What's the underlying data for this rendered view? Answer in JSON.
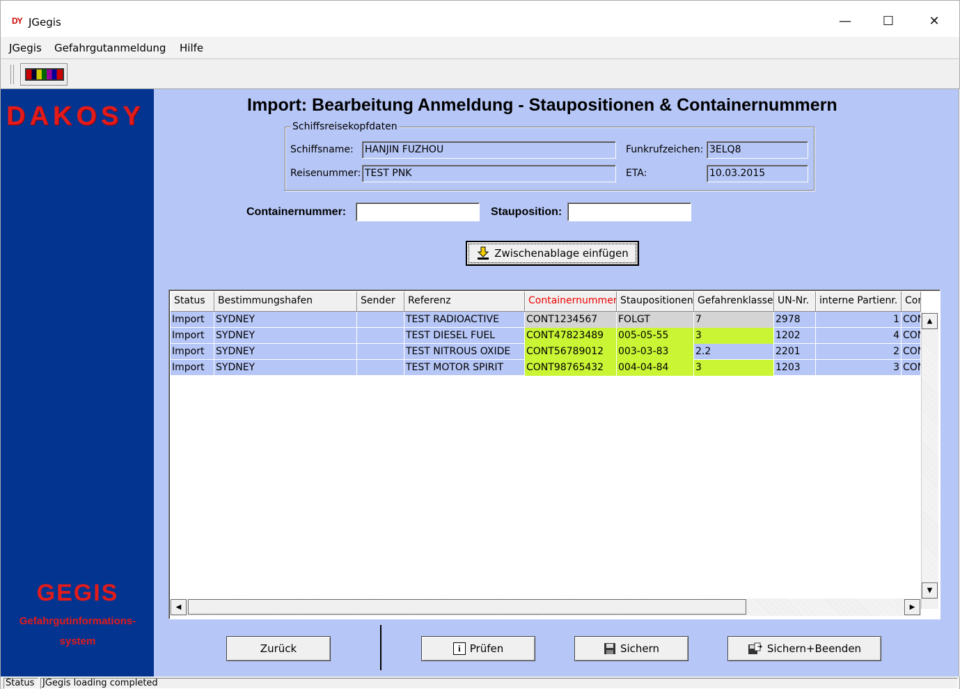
{
  "window": {
    "logo": "DY",
    "title": "JGegis",
    "minimize_glyph": "—",
    "maximize_glyph": "☐",
    "close_glyph": "✕"
  },
  "menu": [
    "JGegis",
    "Gefahrgutanmeldung",
    "Hilfe"
  ],
  "toolbar": {
    "button_icon": "color-bars-icon"
  },
  "sidebar": {
    "brand": "DAKOSY",
    "product": "GEGIS",
    "subtitle_line1": "Gefahrgutinformations-",
    "subtitle_line2": "system",
    "brand_color": "#e21b1b",
    "bg_color": "#033490"
  },
  "page": {
    "title": "Import: Bearbeitung Anmeldung - Staupositionen & Containernummern"
  },
  "header_group": {
    "legend": "Schiffsreisekopfdaten",
    "schiffsname_label": "Schiffsname:",
    "schiffsname": "HANJIN FUZHOU",
    "funkruf_label": "Funkrufzeichen:",
    "funkruf": "3ELQ8",
    "reise_label": "Reisenummer:",
    "reise": "TEST PNK",
    "eta_label": "ETA:",
    "eta": "10.03.2015"
  },
  "search": {
    "container_label": "Containernummer:",
    "container_value": "",
    "stau_label": "Stauposition:",
    "stau_value": ""
  },
  "clipboard_button": {
    "label": "Zwischenablage einfügen",
    "icon": "paste-arrow-icon"
  },
  "table": {
    "columns": [
      "Status",
      "Bestimmungshafen",
      "Sender",
      "Referenz",
      "Containernummer",
      "Staupositionen",
      "Gefahrenklasse",
      "UN-Nr.",
      "interne Partienr.",
      "Cor"
    ],
    "rows": [
      {
        "status": "Import",
        "hafen": "SYDNEY",
        "sender": "",
        "referenz": "TEST RADIOACTIVE",
        "container": "CONT1234567",
        "stau": "FOLGT",
        "klasse": "7",
        "un": "2978",
        "partie": "1",
        "cor": "CON"
      },
      {
        "status": "Import",
        "hafen": "SYDNEY",
        "sender": "",
        "referenz": "TEST DIESEL FUEL",
        "container": "CONT47823489",
        "stau": "005-05-55",
        "klasse": "3",
        "un": "1202",
        "partie": "4",
        "cor": "CON"
      },
      {
        "status": "Import",
        "hafen": "SYDNEY",
        "sender": "",
        "referenz": "TEST NITROUS OXIDE",
        "container": "CONT56789012",
        "stau": "003-03-83",
        "klasse": "2.2",
        "un": "2201",
        "partie": "2",
        "cor": "CON"
      },
      {
        "status": "Import",
        "hafen": "SYDNEY",
        "sender": "",
        "referenz": "TEST MOTOR SPIRIT",
        "container": "CONT98765432",
        "stau": "004-04-84",
        "klasse": "3",
        "un": "1203",
        "partie": "3",
        "cor": "CON"
      }
    ],
    "highlight_color": "#c9f535",
    "row_color": "#b6c6f6"
  },
  "buttons": {
    "back": "Zurück",
    "check": "Prüfen",
    "save": "Sichern",
    "save_exit": "Sichern+Beenden"
  },
  "statusbar": {
    "label": "Status",
    "message": "JGegis loading completed"
  }
}
